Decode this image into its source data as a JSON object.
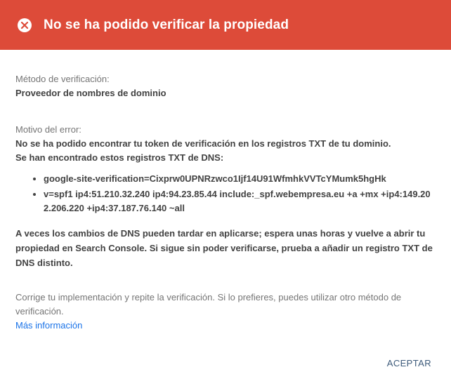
{
  "dialog": {
    "title": "No se ha podido verificar la propiedad",
    "header_color": "#dd4b39",
    "icon": "close-circle-icon"
  },
  "method": {
    "label": "Método de verificación:",
    "value": "Proveedor de nombres de dominio"
  },
  "error": {
    "label": "Motivo del error:",
    "line1": "No se ha podido encontrar tu token de verificación en los registros TXT de tu dominio.",
    "line2": "Se han encontrado estos registros TXT de DNS:",
    "records": [
      "google-site-verification=Cixprw0UPNRzwco1Ijf14U91WfmhkVVTcYMumk5hgHk",
      "v=spf1 ip4:51.210.32.240 ip4:94.23.85.44 include:_spf.webempresa.eu +a +mx +ip4:149.202.206.220 +ip4:37.187.76.140 ~all"
    ]
  },
  "dns_note": "A veces los cambios de DNS pueden tardar en aplicarse; espera unas horas y vuelve a abrir tu propiedad en Search Console. Si sigue sin poder verificarse, prueba a añadir un registro TXT de DNS distinto.",
  "footer": {
    "note": "Corrige tu implementación y repite la verificación. Si lo prefieres, puedes utilizar otro método de verificación.",
    "link": "Más información",
    "link_color": "#1a73e8"
  },
  "actions": {
    "accept_label": "ACEPTAR"
  }
}
